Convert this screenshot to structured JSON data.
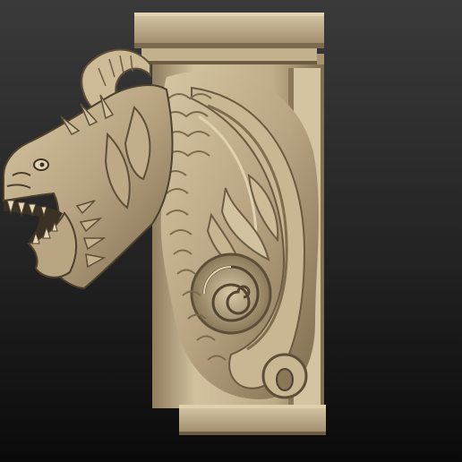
{
  "scene": {
    "subject": "sculpted-dragon-corbel",
    "colors": {
      "bg_top": "#3a3a3a",
      "bg_bottom": "#0a0a0a",
      "clay_light": "#d8c8a6",
      "clay_mid": "#b39f7d",
      "clay_dark": "#6e5d43",
      "clay_shadow": "#3b3124"
    }
  }
}
